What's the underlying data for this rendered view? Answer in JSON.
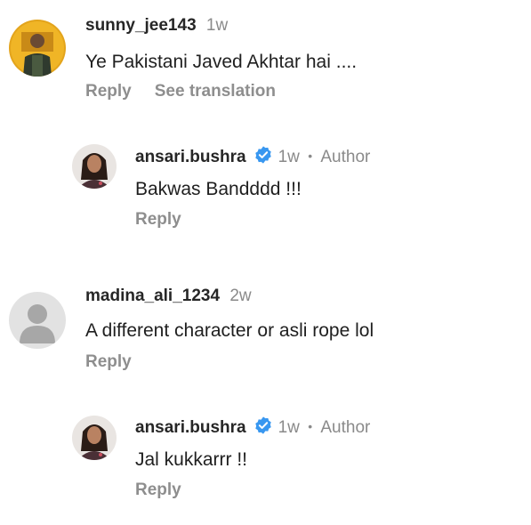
{
  "comments": [
    {
      "username": "sunny_jee143",
      "time": "1w",
      "text": "Ye Pakistani Javed Akhtar hai ....",
      "reply_label": "Reply",
      "translate_label": "See translation"
    },
    {
      "username": "ansari.bushra",
      "time": "1w",
      "separator": "•",
      "badge": "Author",
      "text": "Bakwas Bandddd !!!",
      "reply_label": "Reply"
    },
    {
      "username": "madina_ali_1234",
      "time": "2w",
      "text": "A different character or asli rope lol",
      "reply_label": "Reply"
    },
    {
      "username": "ansari.bushra",
      "time": "1w",
      "separator": "•",
      "badge": "Author",
      "text": "Jal kukkarrr !!",
      "reply_label": "Reply"
    }
  ],
  "colors": {
    "verified_badge": "#3897f0",
    "secondary_text": "#8e8e8e",
    "primary_text": "#1f1f1f"
  }
}
